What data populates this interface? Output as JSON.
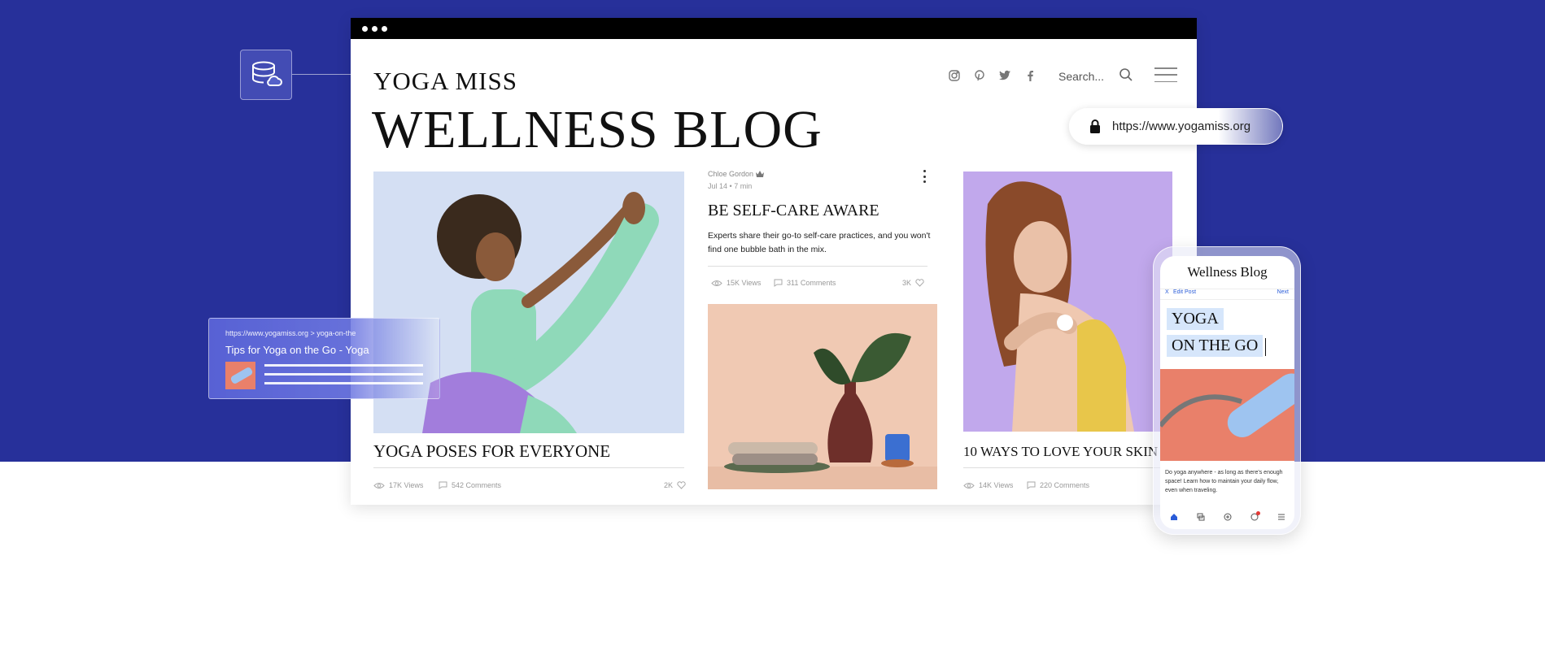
{
  "colors": {
    "brand_blue": "#27309a",
    "link_blue": "#2a5cd8"
  },
  "site": {
    "name": "YOGA MISS",
    "blog_title": "WELLNESS BLOG",
    "search_placeholder": "Search...",
    "social_icons": [
      "instagram-icon",
      "pinterest-icon",
      "twitter-icon",
      "facebook-icon"
    ]
  },
  "posts": [
    {
      "title": "YOGA POSES FOR EVERYONE",
      "views": "17K Views",
      "comments": "542 Comments",
      "likes": "2K"
    },
    {
      "author": "Chloe Gordon",
      "date": "Jul 14",
      "read_time": "7 min",
      "title": "BE SELF-CARE AWARE",
      "excerpt": "Experts share their go-to self-care practices, and you won't find one bubble bath in the mix.",
      "views": "15K Views",
      "comments": "311 Comments",
      "likes": "3K"
    },
    {
      "title": "10 WAYS TO LOVE YOUR SKIN",
      "views": "14K Views",
      "comments": "220 Comments"
    }
  ],
  "url_bar": {
    "url": "https://www.yogamiss.org"
  },
  "seo_snippet": {
    "url": "https://www.yogamiss.org > yoga-on-the",
    "title": "Tips for Yoga on the Go - Yoga"
  },
  "phone": {
    "title": "Wellness Blog",
    "close_label": "X",
    "edit_label": "Edit Post",
    "next_label": "Next",
    "headline_line1": "YOGA",
    "headline_line2": "ON THE GO",
    "body": "Do yoga anywhere - as long as there's enough space! Learn how to maintain your daily flow, even when traveling.",
    "nav_icons": [
      "home-icon",
      "chat-icon",
      "add-icon",
      "notifications-icon",
      "menu-icon"
    ]
  }
}
